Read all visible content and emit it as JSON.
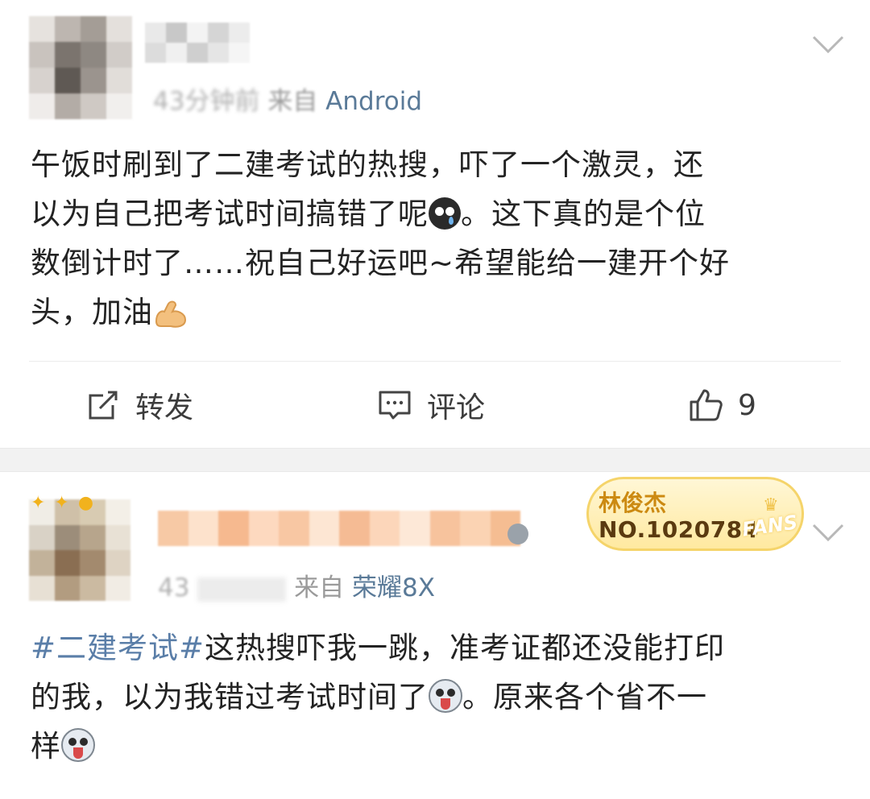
{
  "post1": {
    "time": "43分钟前",
    "source_prefix": "来自",
    "source": "Android",
    "text_lines": [
      "午饭时刷到了二建考试的热搜，吓了一个激灵，还",
      "以为自己把考试时间搞错了呢",
      "。这下真的是个位",
      "数倒计时了……祝自己好运吧~希望能给一建开个好",
      "头，加油"
    ],
    "actions": {
      "repost_label": "转发",
      "comment_label": "评论",
      "like_count": "9"
    }
  },
  "post2": {
    "time": "43",
    "source_prefix": "来自",
    "source": "荣耀8X",
    "fans_badge": {
      "name": "林俊杰",
      "number": "NO.1020784",
      "tag": "FANS"
    },
    "topic": "#二建考试#",
    "text_lines": [
      "这热搜吓我一跳，准考证都还没能打印",
      "的我，以为我错过考试时间了",
      "。原来各个省不一",
      "样"
    ]
  },
  "icons": {
    "more": "chevron-down-icon",
    "repost": "repost-icon",
    "comment": "comment-icon",
    "like": "thumbs-up-icon",
    "emoji_cry": "crying-face-emoji",
    "emoji_muscle": "flexed-biceps-emoji",
    "emoji_husky": "husky-face-emoji"
  },
  "colors": {
    "link": "#5a7ea8",
    "meta": "#9a9a9a",
    "badge_gold": "#f5d46a"
  }
}
